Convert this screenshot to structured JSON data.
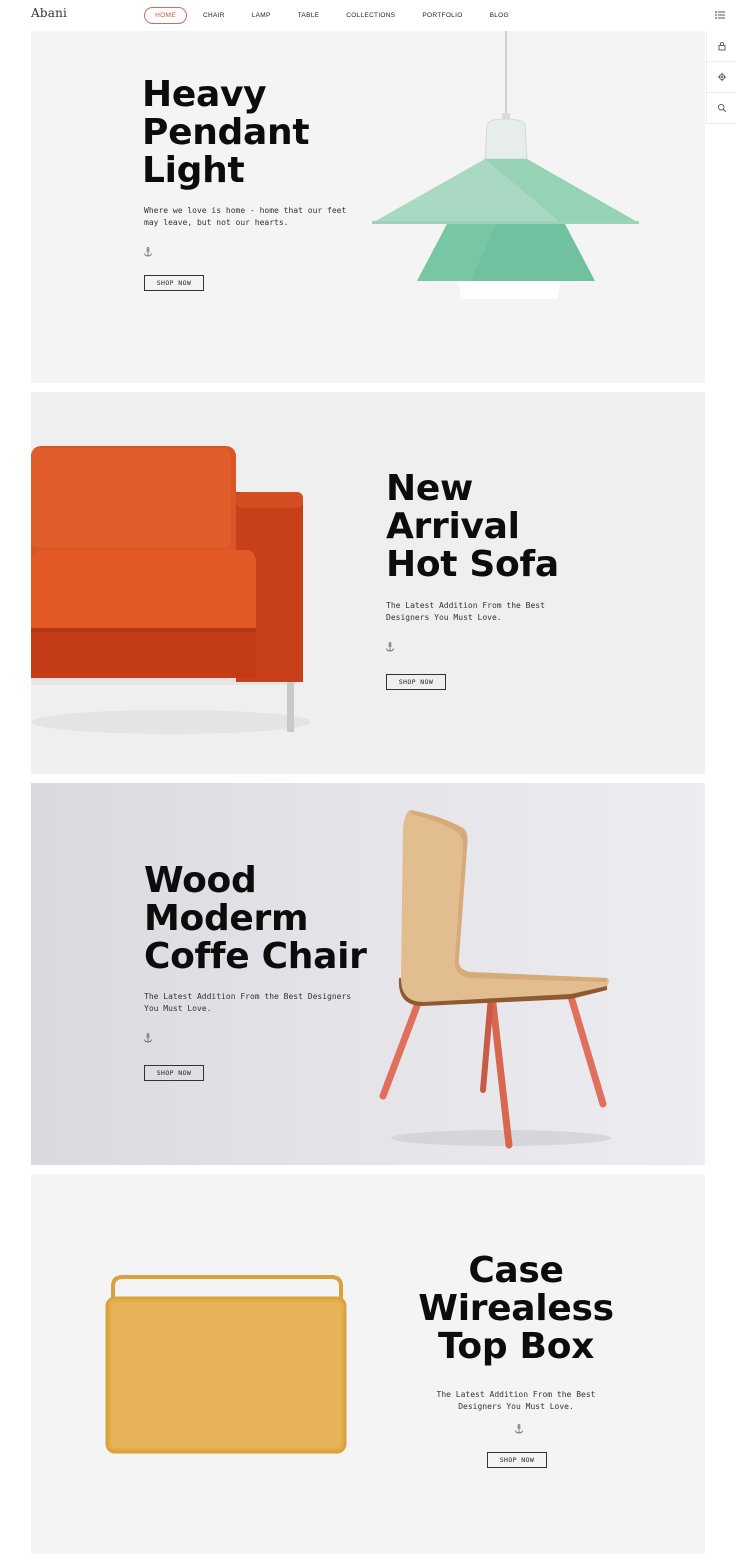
{
  "header": {
    "logo": "Abani",
    "nav": [
      "HOME",
      "CHAIR",
      "LAMP",
      "TABLE",
      "COLLECTIONS",
      "PORTFOLIO",
      "BLOG"
    ],
    "menu_icon": "list-menu-icon"
  },
  "side_tools": {
    "icons": [
      "lock-icon",
      "gear-icon",
      "search-icon"
    ]
  },
  "panels": [
    {
      "title_lines": [
        "Heavy",
        "Pendant",
        "Light"
      ],
      "desc_lines": [
        "Where we love is home - home that our feet",
        "may leave, but not our hearts."
      ],
      "button": "SHOP NOW",
      "image": "pendant-lamp"
    },
    {
      "title_lines": [
        "New",
        "Arrival",
        "Hot Sofa"
      ],
      "desc_lines": [
        "The Latest Addition From  the Best",
        "Designers You Must Love."
      ],
      "button": "SHOP NOW",
      "image": "orange-armchair"
    },
    {
      "title_lines": [
        "Wood",
        "Moderm",
        "Coffe Chair"
      ],
      "desc_lines": [
        "The Latest Addition From  the Best Designers",
        "You Must Love."
      ],
      "button": "SHOP NOW",
      "image": "wooden-chair"
    },
    {
      "title_lines": [
        "Case",
        "Wirealess",
        "Top Box"
      ],
      "desc_lines": [
        "The Latest Addition From  the Best",
        "Designers You Must Love."
      ],
      "button": "SHOP NOW",
      "image": "yellow-speaker"
    }
  ],
  "colors": {
    "active_nav": "#c25548",
    "lamp_green": "#8fcfae",
    "sofa_orange": "#d2451b",
    "chair_legs": "#e0705c",
    "speaker_yellow": "#e2ad4a"
  }
}
